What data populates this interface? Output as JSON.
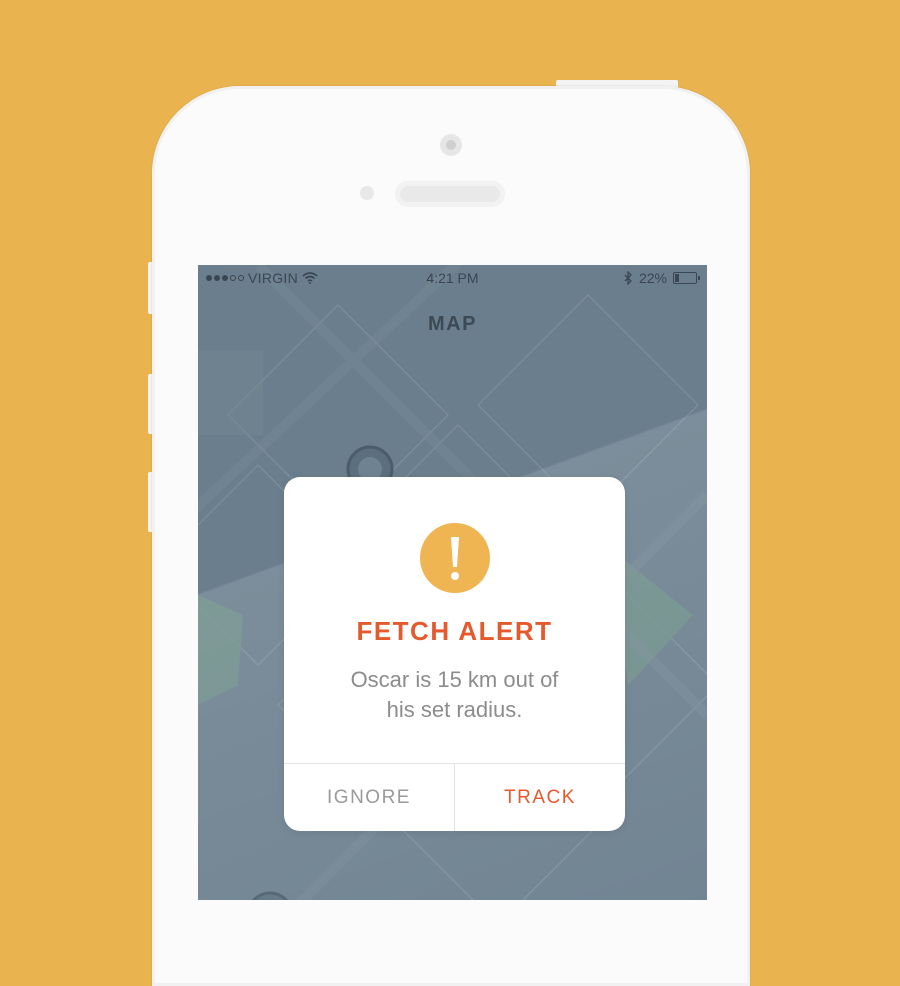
{
  "status_bar": {
    "carrier": "VIRGIN",
    "time": "4:21 PM",
    "battery_percent": "22%",
    "battery_level": 0.22,
    "signal_dots_filled": 3,
    "signal_dots_total": 5
  },
  "nav": {
    "title": "MAP"
  },
  "alert": {
    "icon": "exclamation-icon",
    "title": "FETCH ALERT",
    "message_line1": "Oscar is 15 km out of",
    "message_line2": "his set radius.",
    "ignore_label": "IGNORE",
    "track_label": "TRACK"
  },
  "colors": {
    "background": "#E9B450",
    "accent_orange": "#E55A2C",
    "icon_yellow": "#EFB552",
    "map_base": "#6A7E8D",
    "map_green": "#6E9088"
  }
}
